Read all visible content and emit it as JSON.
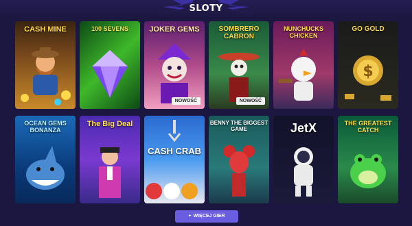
{
  "section": {
    "title": "SLOTY",
    "more_button": "WIĘCEJ GIER",
    "more_icon": "plus-icon"
  },
  "games": [
    {
      "title": "CASH MINE",
      "badge": ""
    },
    {
      "title": "100 SEVENS",
      "badge": ""
    },
    {
      "title": "JOKER GEMS",
      "badge": "NOWOŚĆ"
    },
    {
      "title": "SOMBRERO CABRON",
      "badge": "NOWOŚĆ"
    },
    {
      "title": "NUNCHUCKS CHICKEN",
      "badge": ""
    },
    {
      "title": "GO GOLD",
      "badge": ""
    },
    {
      "title": "OCEAN GEMS BONANZA",
      "badge": ""
    },
    {
      "title": "The Big Deal",
      "badge": ""
    },
    {
      "title": "CASH CRAB",
      "badge": ""
    },
    {
      "title": "BENNY THE BIGGEST GAME",
      "badge": ""
    },
    {
      "title": "JetX",
      "badge": ""
    },
    {
      "title": "THE GREATEST CATCH",
      "badge": ""
    }
  ],
  "colors": {
    "background": "#1c1740",
    "button": "#6b5de0"
  }
}
